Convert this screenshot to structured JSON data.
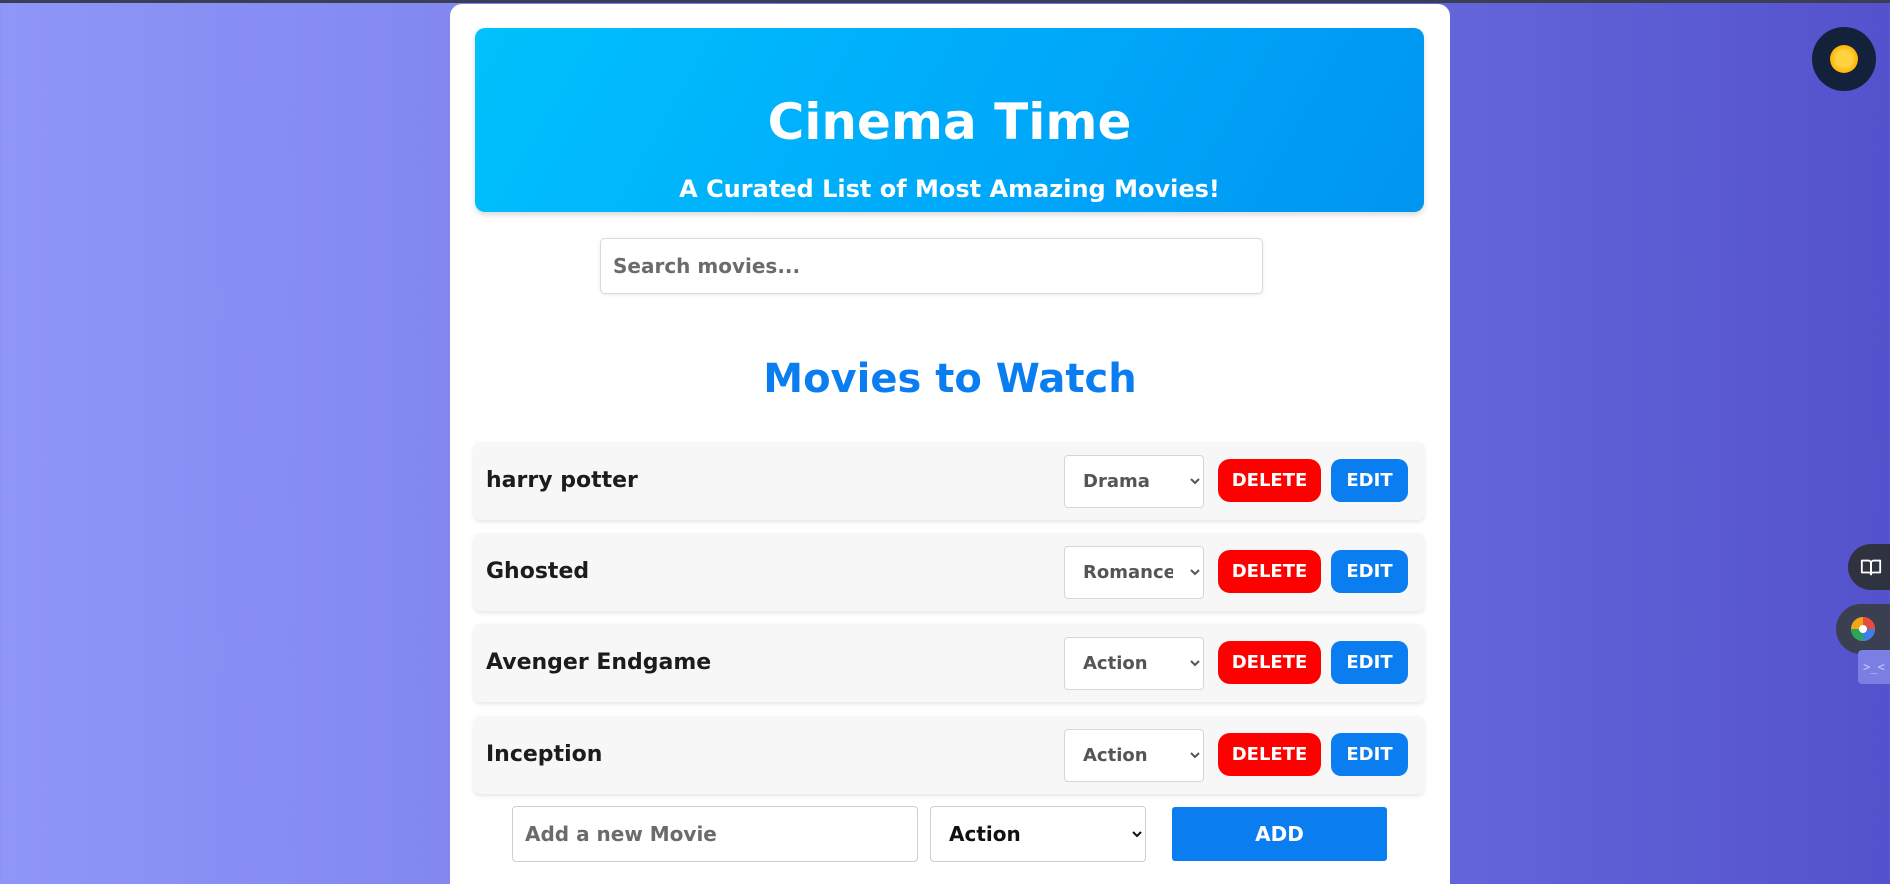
{
  "header": {
    "title": "Cinema Time",
    "subtitle": "A Curated List of Most Amazing Movies!"
  },
  "search": {
    "placeholder": "Search movies..."
  },
  "list": {
    "title": "Movies to Watch",
    "delete_label": "DELETE",
    "edit_label": "EDIT",
    "movies": [
      {
        "name": "harry potter",
        "genre": "Drama"
      },
      {
        "name": "Ghosted",
        "genre": "Romance"
      },
      {
        "name": "Avenger Endgame",
        "genre": "Action"
      },
      {
        "name": "Inception",
        "genre": "Action"
      }
    ]
  },
  "add_form": {
    "placeholder": "Add a new Movie",
    "genre": "Action",
    "button_label": "ADD"
  },
  "side_tools": {
    "theme_icon": "sun-icon",
    "reader_icon": "book-icon",
    "extension_icon": "color-wheel-icon",
    "tab_glyph": ">_<"
  },
  "colors": {
    "accent": "#0a7df0",
    "delete": "#ff0000",
    "hero_start": "#00c2fc",
    "hero_end": "#0095f0"
  }
}
